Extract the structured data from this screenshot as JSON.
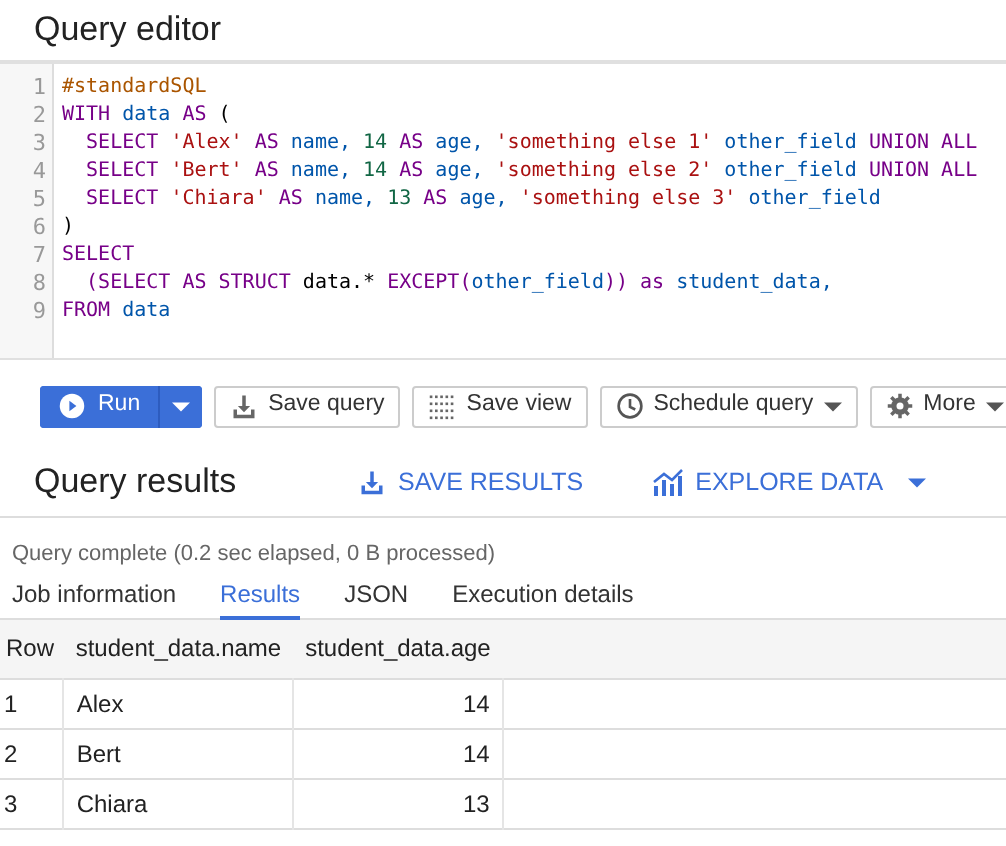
{
  "title": "Query editor",
  "editor": {
    "lines": [
      [
        {
          "t": "#standardSQL",
          "kind": "comment"
        }
      ],
      [
        {
          "t": "WITH",
          "kind": "keyword"
        },
        {
          "t": " data ",
          "kind": "ident"
        },
        {
          "t": "AS",
          "kind": "keyword"
        },
        {
          "t": " (",
          "kind": "plain"
        }
      ],
      [
        {
          "t": "  SELECT ",
          "kind": "keyword"
        },
        {
          "t": "'Alex'",
          "kind": "string"
        },
        {
          "t": " AS ",
          "kind": "keyword"
        },
        {
          "t": "name, ",
          "kind": "ident"
        },
        {
          "t": "14",
          "kind": "number"
        },
        {
          "t": " AS ",
          "kind": "keyword"
        },
        {
          "t": "age, ",
          "kind": "ident"
        },
        {
          "t": "'something else 1'",
          "kind": "string"
        },
        {
          "t": " other_field ",
          "kind": "ident"
        },
        {
          "t": "UNION ALL",
          "kind": "keyword"
        }
      ],
      [
        {
          "t": "  SELECT ",
          "kind": "keyword"
        },
        {
          "t": "'Bert'",
          "kind": "string"
        },
        {
          "t": " AS ",
          "kind": "keyword"
        },
        {
          "t": "name, ",
          "kind": "ident"
        },
        {
          "t": "14",
          "kind": "number"
        },
        {
          "t": " AS ",
          "kind": "keyword"
        },
        {
          "t": "age, ",
          "kind": "ident"
        },
        {
          "t": "'something else 2'",
          "kind": "string"
        },
        {
          "t": " other_field ",
          "kind": "ident"
        },
        {
          "t": "UNION ALL",
          "kind": "keyword"
        }
      ],
      [
        {
          "t": "  SELECT ",
          "kind": "keyword"
        },
        {
          "t": "'Chiara'",
          "kind": "string"
        },
        {
          "t": " AS ",
          "kind": "keyword"
        },
        {
          "t": "name, ",
          "kind": "ident"
        },
        {
          "t": "13",
          "kind": "number"
        },
        {
          "t": " AS ",
          "kind": "keyword"
        },
        {
          "t": "age, ",
          "kind": "ident"
        },
        {
          "t": "'something else 3'",
          "kind": "string"
        },
        {
          "t": " other_field",
          "kind": "ident"
        }
      ],
      [
        {
          "t": ")",
          "kind": "plain"
        }
      ],
      [
        {
          "t": "SELECT",
          "kind": "keyword"
        }
      ],
      [
        {
          "t": "  (SELECT AS STRUCT ",
          "kind": "keyword"
        },
        {
          "t": "data.* ",
          "kind": "plain"
        },
        {
          "t": "EXCEPT(",
          "kind": "keyword"
        },
        {
          "t": "other_field",
          "kind": "ident"
        },
        {
          "t": ")) as ",
          "kind": "keyword"
        },
        {
          "t": "student_data,",
          "kind": "ident"
        }
      ],
      [
        {
          "t": "FROM ",
          "kind": "keyword"
        },
        {
          "t": "data",
          "kind": "ident"
        }
      ]
    ],
    "line_numbers": [
      "1",
      "2",
      "3",
      "4",
      "5",
      "6",
      "7",
      "8",
      "9"
    ]
  },
  "toolbar": [
    {
      "label": "Run",
      "kind": "primary",
      "dropdown": true
    },
    {
      "label": "Save query",
      "kind": "secondary",
      "dropdown": false
    },
    {
      "label": "Save view",
      "kind": "secondary",
      "dropdown": false
    },
    {
      "label": "Schedule query",
      "kind": "secondary",
      "dropdown": true
    },
    {
      "label": "More",
      "kind": "secondary",
      "dropdown": true
    }
  ],
  "results": {
    "title": "Query results",
    "actions": [
      {
        "label": "SAVE RESULTS",
        "dropdown": false
      },
      {
        "label": "EXPLORE DATA",
        "dropdown": true
      }
    ],
    "status": "Query complete (0.2 sec elapsed, 0 B processed)",
    "tabs": [
      {
        "label": "Job information",
        "selected": false
      },
      {
        "label": "Results",
        "selected": true
      },
      {
        "label": "JSON",
        "selected": false
      },
      {
        "label": "Execution details",
        "selected": false
      }
    ],
    "table": {
      "columns": [
        "Row",
        "student_data.name",
        "student_data.age"
      ],
      "rows": [
        [
          "1",
          "Alex",
          "14"
        ],
        [
          "2",
          "Bert",
          "14"
        ],
        [
          "3",
          "Chiara",
          "13"
        ]
      ]
    }
  }
}
